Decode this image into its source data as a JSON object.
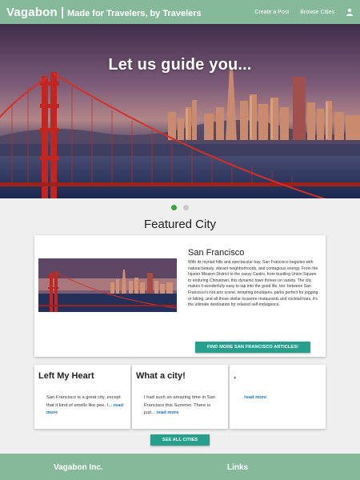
{
  "nav": {
    "brand": "Vagabon",
    "separator": "|",
    "tagline": "Made for Travelers, by Travelers",
    "links": [
      "Create a Post",
      "Browse Cities"
    ],
    "user_icon": "person-icon"
  },
  "hero": {
    "headline": "Let us guide you..."
  },
  "carousel": {
    "slide_count": 2,
    "active_index": 0
  },
  "featured": {
    "section_title": "Featured City",
    "city_name": "San Francisco",
    "description": "With its myriad hills and spectacular bay, San Francisco beguiles with natural beauty, vibrant neighborhoods, and contagious energy. From the hipster Mission District to the sassy Castro, from bustling Union Square to enduring Chinatown, this dynamic town thrives on variety. The city makes it wonderfully easy to tap into the good life, too: between San Francisco's hot arts scene, tempting boutiques, parks perfect for jogging or biking, and all those stellar locavore restaurants and cocktail bars, it's the ultimate destination for relaxed self-indulgence.",
    "button_label": "Find more San Francisco articles!"
  },
  "articles": [
    {
      "title": "Left My Heart",
      "excerpt": "San Francisco is a great city, except that it kind of smells like pee. I...",
      "read_more": "read more"
    },
    {
      "title": "What a city!",
      "excerpt": "I had such an amazing time in San Francisco this Summer. There is just...",
      "read_more": "read more"
    },
    {
      "title": ".",
      "excerpt": ".",
      "read_more": "read more"
    }
  ],
  "see_all_label": "See all cities",
  "footer": {
    "company": "Vagabon Inc.",
    "links_heading": "Links"
  },
  "colors": {
    "nav_bg": "#86b89a",
    "accent_button": "#26a08c",
    "active_dot": "#3aa33f",
    "link": "#1a73c7"
  }
}
